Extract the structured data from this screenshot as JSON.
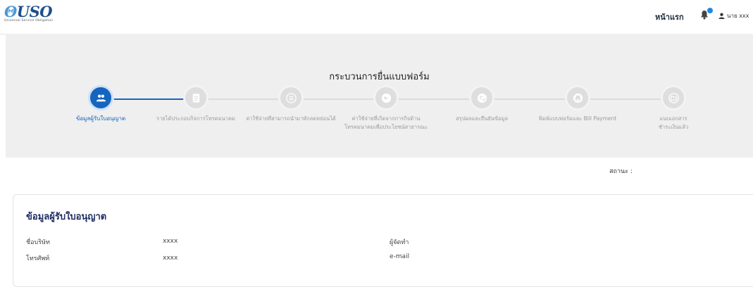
{
  "header": {
    "logo_text": "USO",
    "logo_ring": "Θ",
    "logo_subtitle": "Universal Service Obligation",
    "nav_home": "หน้าแรก",
    "notification_count": "",
    "user_label": "นาย xxx"
  },
  "process": {
    "title": "กระบวนการยื่นแบบฟอร์ม",
    "steps": [
      {
        "label": "ข้อมูลผู้รับใบอนุญาต",
        "icon": "people-icon",
        "active": true
      },
      {
        "label": "รายได้ประกอบกิจการโทรคมนาคม",
        "icon": "document-icon",
        "active": false
      },
      {
        "label": "ค่าใช้จ่ายที่สามารถนำมาหักลดหย่อนได้",
        "icon": "list-icon",
        "active": false
      },
      {
        "label": "ค่าใช้จ่ายที่เกิดจากการกิจด้าน\nโทรคมนาคมเพื่อประโยชน์สาธารณะ",
        "icon": "globe-icon",
        "active": false
      },
      {
        "label": "สรุปผลและยืนยันข้อมูล",
        "icon": "checklist-icon",
        "active": false
      },
      {
        "label": "พิมพ์แบบฟอร์มและ Bill Payment",
        "icon": "printer-icon",
        "active": false
      },
      {
        "label": "แนบเอกสาร\nชำระเงินแล้ว",
        "icon": "folder-icon",
        "active": false
      }
    ]
  },
  "status": {
    "label": "สถานะ :",
    "value": ""
  },
  "licensee": {
    "title": "ข้อมูลผู้รับใบอนุญาต",
    "company_label": "ชื่อบริษัท",
    "company_value": "xxxx",
    "phone_label": "โทรศัพท์",
    "phone_value": "xxxx",
    "preparer_label": "ผู้จัดทำ",
    "preparer_value": "",
    "email_label": "e-mail",
    "email_value": ""
  },
  "colors": {
    "accent": "#1565c0",
    "band": "#efefef",
    "title": "#1f2d63"
  }
}
